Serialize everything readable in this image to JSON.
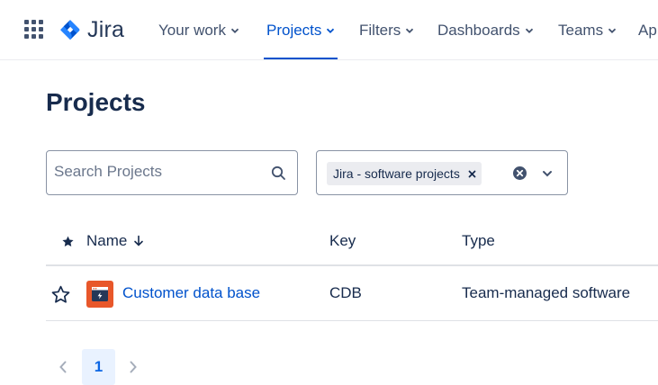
{
  "app": {
    "name": "Jira"
  },
  "nav": {
    "items": [
      {
        "label": "Your work",
        "active": false
      },
      {
        "label": "Projects",
        "active": true
      },
      {
        "label": "Filters",
        "active": false
      },
      {
        "label": "Dashboards",
        "active": false
      },
      {
        "label": "Teams",
        "active": false
      },
      {
        "label": "Ap",
        "active": false
      }
    ]
  },
  "page": {
    "title": "Projects"
  },
  "search": {
    "placeholder": "Search Projects",
    "value": ""
  },
  "filter": {
    "chip_label": "Jira - software projects"
  },
  "table": {
    "columns": {
      "name": "Name",
      "key": "Key",
      "type": "Type"
    },
    "rows": [
      {
        "name": "Customer data base",
        "key": "CDB",
        "type": "Team-managed software"
      }
    ]
  },
  "pagination": {
    "current": "1"
  },
  "colors": {
    "brand": "#0052cc",
    "avatar": "#e8572a",
    "text": "#172b4d",
    "muted": "#42526e"
  },
  "icons": [
    "app-switcher-icon",
    "jira-logo-icon",
    "chevron-down-icon",
    "search-icon",
    "close-icon",
    "clear-icon",
    "star-icon",
    "arrow-down-icon",
    "project-avatar-icon",
    "chevron-left-icon",
    "chevron-right-icon"
  ]
}
